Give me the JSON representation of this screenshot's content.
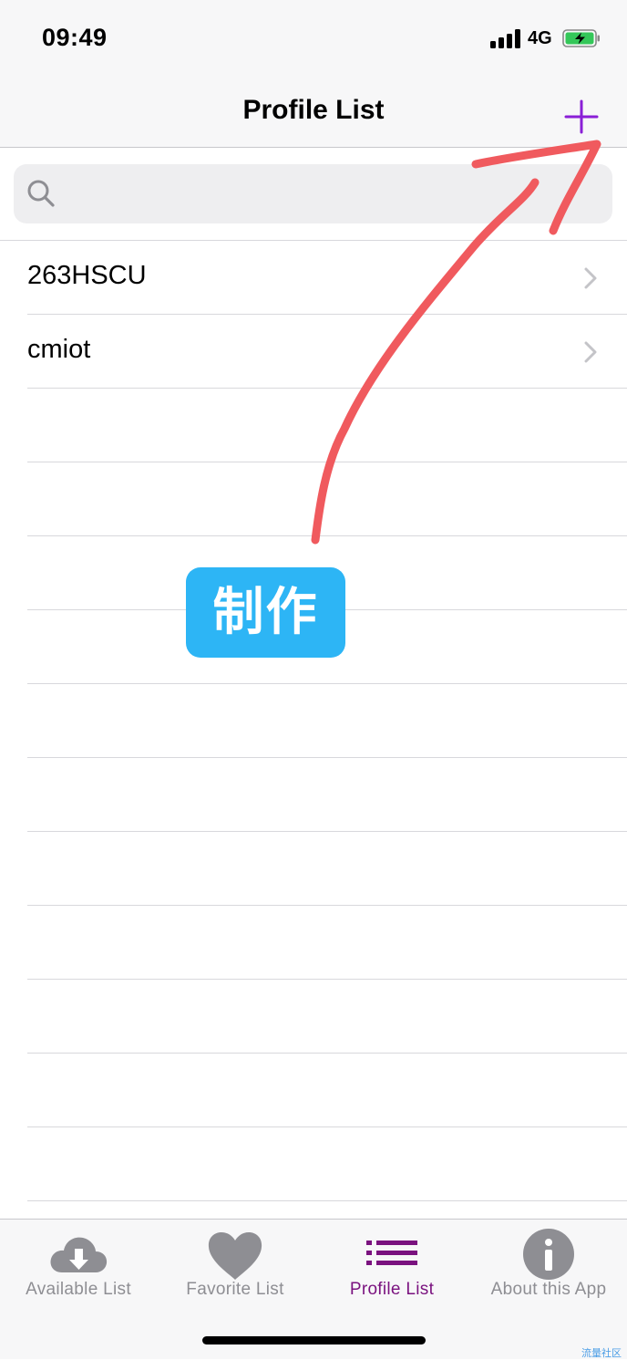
{
  "status_bar": {
    "time": "09:49",
    "network": "4G"
  },
  "nav": {
    "title": "Profile List",
    "add_icon": "plus-icon"
  },
  "search": {
    "placeholder": "",
    "value": ""
  },
  "profiles": [
    {
      "label": "263HSCU"
    },
    {
      "label": "cmiot"
    }
  ],
  "empty_rows": 11,
  "annotation": {
    "label": "制作",
    "arrow_color": "#f05a5e",
    "label_bg": "#2db5f5"
  },
  "tabs": [
    {
      "label": "Available List",
      "icon": "cloud-download-icon"
    },
    {
      "label": "Favorite List",
      "icon": "heart-icon"
    },
    {
      "label": "Profile List",
      "icon": "list-icon",
      "active": true
    },
    {
      "label": "About this App",
      "icon": "info-icon"
    }
  ],
  "watermark": "流量社区",
  "colors": {
    "accent": "#7a127f",
    "plus": "#8a1fd6",
    "battery": "#34c759",
    "inactive": "#8e8e93"
  }
}
